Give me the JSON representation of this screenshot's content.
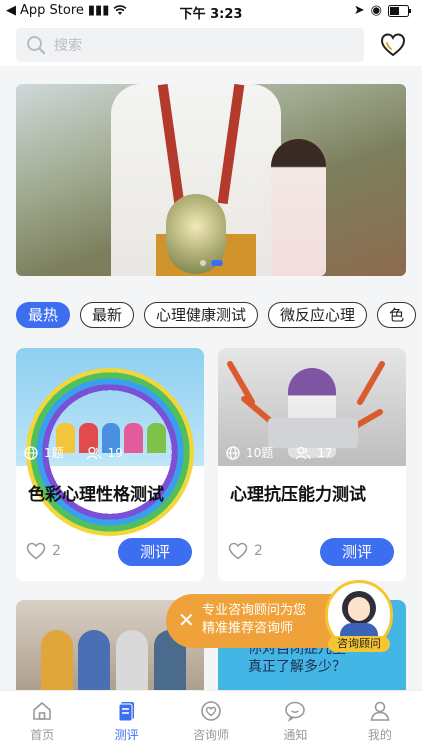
{
  "status_bar": {
    "back_app": "App Store",
    "time": "下午 3:23"
  },
  "search": {
    "placeholder": "搜索",
    "icon": "search-icon",
    "favorite_icon": "heart-icon"
  },
  "banner": {
    "slide_count": 2,
    "active_index": 1
  },
  "tags": [
    {
      "label": "最热",
      "active": true
    },
    {
      "label": "最新",
      "active": false
    },
    {
      "label": "心理健康测试",
      "active": false
    },
    {
      "label": "微反应心理",
      "active": false
    },
    {
      "label": "色",
      "active": false
    }
  ],
  "cards": [
    {
      "title": "色彩心理性格测试",
      "questions": "1题",
      "participants": "19",
      "likes": "2",
      "button": "测评"
    },
    {
      "title": "心理抗压能力测试",
      "questions": "10题",
      "participants": "17",
      "likes": "2",
      "button": "测评"
    }
  ],
  "lower_cards": {
    "right_text_1": "你对自闭症儿童",
    "right_text_2": "真正了解多少？"
  },
  "consult": {
    "line1": "专业咨询顾问为您",
    "line2": "精准推荐咨询师",
    "advisor_label": "咨询顾问",
    "close_icon": "close-icon"
  },
  "tabbar": [
    {
      "label": "首页",
      "icon": "home-icon",
      "active": false
    },
    {
      "label": "测评",
      "icon": "test-icon",
      "active": true
    },
    {
      "label": "咨询师",
      "icon": "counselor-icon",
      "active": false
    },
    {
      "label": "通知",
      "icon": "chat-icon",
      "active": false
    },
    {
      "label": "我的",
      "icon": "user-icon",
      "active": false
    }
  ],
  "colors": {
    "accent": "#3e6ef0",
    "consult_orange": "#f0a23a",
    "advisor_yellow": "#f5c631"
  }
}
